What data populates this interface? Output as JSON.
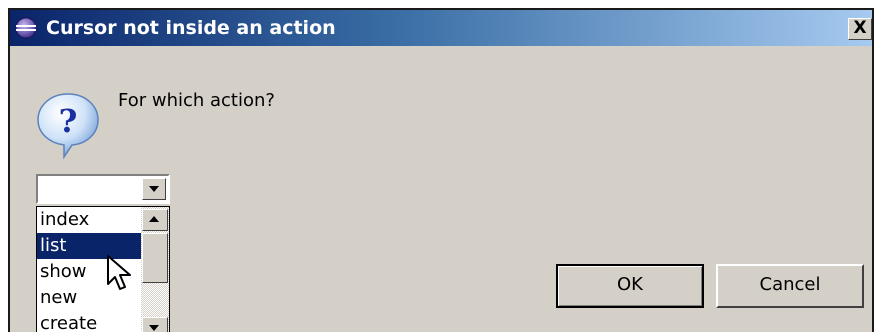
{
  "window": {
    "title": "Cursor not inside an action",
    "close_label": "X"
  },
  "dialog": {
    "message": "For which action?",
    "icon": "question-icon"
  },
  "combo": {
    "value": "",
    "options": [
      {
        "label": "index",
        "selected": false
      },
      {
        "label": "list",
        "selected": true
      },
      {
        "label": "show",
        "selected": false
      },
      {
        "label": "new",
        "selected": false
      },
      {
        "label": "create",
        "selected": false
      }
    ]
  },
  "buttons": {
    "ok_label": "OK",
    "cancel_label": "Cancel"
  },
  "colors": {
    "title_start": "#0a246a",
    "title_end": "#a6caf0",
    "selection": "#0a246a",
    "face": "#d4d0c8"
  }
}
